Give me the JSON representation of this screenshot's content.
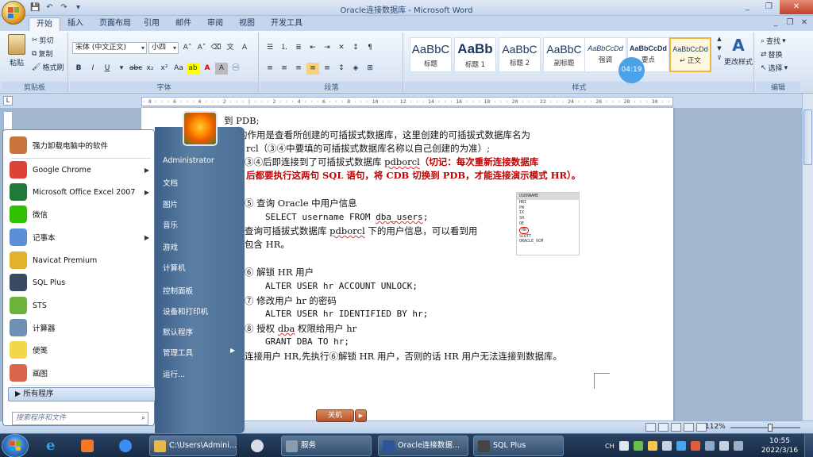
{
  "window": {
    "title": "Oracle连接数据库 - Microsoft Word",
    "controls": [
      "_",
      "❐",
      "✕"
    ]
  },
  "ribbon": {
    "tabs": [
      "开始",
      "插入",
      "页面布局",
      "引用",
      "邮件",
      "审阅",
      "视图",
      "开发工具"
    ],
    "clipboard": {
      "paste": "粘贴",
      "cut": "剪切",
      "copy": "复制",
      "format_painter": "格式刷",
      "label": "剪贴板"
    },
    "font": {
      "family": "宋体 (中文正文)",
      "size": "小四",
      "label": "字体"
    },
    "paragraph": {
      "label": "段落"
    },
    "styles": {
      "items": [
        {
          "sample": "AaBbC",
          "name": "标题"
        },
        {
          "sample": "AaBb",
          "name": "标题 1"
        },
        {
          "sample": "AaBbC",
          "name": "标题 2"
        },
        {
          "sample": "AaBbC",
          "name": "副标题"
        },
        {
          "sample": "AaBbCcDd",
          "name": "强调"
        },
        {
          "sample": "AaBbCcDd",
          "name": "要点"
        },
        {
          "sample": "AaBbCcDd",
          "name": "↵ 正文"
        }
      ],
      "change_styles": "更改样式",
      "label": "样式"
    },
    "editing": {
      "find": "查找",
      "replace": "替换",
      "select": "选择",
      "label": "编辑"
    },
    "timer": "04:19"
  },
  "ruler": {
    "marks": "· 8 · · · 6 · · · 4 · · · 2 · · · | · · · 2 · · · 4 · · · 6 · · · 8 · · · 10 · · · 12 · · · 14 · · · 16 · · · 18 · · · 20 · · · 22 · · · 24 · · · 26 · · · 28 · · · 30 · · · 32 · · · 34 · · · 36 · · · 38 · · · 40 · · · 42 · · · 44 · · · 46 · · · 48"
  },
  "document": {
    "lines": {
      "l1": "到 PDB;",
      "l2": "的作用是查看所创建的可插拔式数据库，这里创建的可插拔式数据库名为",
      "l3a": "rcl（③④中要填的可插拔式数据库名称以自己创建的为准）;",
      "l4a": "③④后即连接到了可插拔式数据库 ",
      "l4b": "pdborcl",
      "l4c": "（切记：每次重新连接数据库",
      "l5": "后都要执行这两句 SQL 语句，将 CDB 切换到 PDB，才能连接演示模式 HR）。",
      "s5_title": "⑤  查询 Oracle 中用户信息",
      "s5_sql_a": "SELECT username FROM ",
      "s5_sql_b": "dba_users",
      "s5_sql_c": ";",
      "s5_desc1a": "查询可插拔式数据库 ",
      "s5_desc1b": "pdborcl",
      "s5_desc1c": " 下的用户信息，可以看到用",
      "s5_desc2": "包含 HR。",
      "s6_title": "⑥  解锁 HR 用户",
      "s6_sql": "ALTER USER hr ACCOUNT UNLOCK;",
      "s7_title": "⑦  修改用户 hr 的密码",
      "s7_sql": "ALTER USER hr IDENTIFIED BY hr;",
      "s8_title_a": "⑧  授权 ",
      "s8_title_b": "dba",
      "s8_title_c": " 权限给用户 hr",
      "s8_sql": "GRANT DBA TO hr;",
      "note": "连接用户 HR,先执行⑥解锁 HR 用户，否则的话 HR 用户无法连接到数据库。"
    },
    "screenshot": {
      "header": "USERNAME",
      "rows": [
        "HRI",
        "PW",
        "IX",
        "SH",
        "OE",
        "HR",
        "SCOTT",
        "ORACLE_OCM"
      ],
      "circled": "HR"
    }
  },
  "statusbar": {
    "zoom": "112%"
  },
  "start_menu": {
    "left_items": [
      {
        "label": "强力卸载电脑中的软件",
        "color": "#c8743a",
        "arrow": ""
      },
      {
        "label": "Google Chrome",
        "color": "#db4437",
        "arrow": "▶"
      },
      {
        "label": "Microsoft Office Excel 2007",
        "color": "#1f7a3a",
        "arrow": "▶"
      },
      {
        "label": "微信",
        "color": "#2dc100",
        "arrow": ""
      },
      {
        "label": "记事本",
        "color": "#5b8fd6",
        "arrow": "▶"
      },
      {
        "label": "Navicat Premium",
        "color": "#e3b22a",
        "arrow": ""
      },
      {
        "label": "SQL Plus",
        "color": "#3a4a60",
        "arrow": ""
      },
      {
        "label": "STS",
        "color": "#6cb33e",
        "arrow": ""
      },
      {
        "label": "计算器",
        "color": "#6f8fb5",
        "arrow": ""
      },
      {
        "label": "便笺",
        "color": "#f2d64b",
        "arrow": ""
      },
      {
        "label": "画图",
        "color": "#d9664a",
        "arrow": ""
      }
    ],
    "all_programs": "所有程序",
    "search_placeholder": "搜索程序和文件",
    "right_items": [
      {
        "label": "Administrator",
        "arrow": ""
      },
      {
        "label": "文档",
        "arrow": ""
      },
      {
        "label": "图片",
        "arrow": ""
      },
      {
        "label": "音乐",
        "arrow": ""
      },
      {
        "label": "游戏",
        "arrow": ""
      },
      {
        "label": "计算机",
        "arrow": ""
      },
      {
        "label": "控制面板",
        "arrow": ""
      },
      {
        "label": "设备和打印机",
        "arrow": ""
      },
      {
        "label": "默认程序",
        "arrow": ""
      },
      {
        "label": "管理工具",
        "arrow": "▶"
      },
      {
        "label": "运行...",
        "arrow": ""
      }
    ],
    "shutdown": "关机"
  },
  "taskbar": {
    "buttons": [
      {
        "label": "C:\\Users\\Admini...",
        "color": "#e6b84a"
      },
      {
        "label": "服务",
        "color": "#8a9bb0"
      },
      {
        "label": "Oracle连接数据...",
        "color": "#2b579a"
      },
      {
        "label": "SQL Plus",
        "color": "#444"
      }
    ],
    "tray_lang": "CH",
    "time": "10:55",
    "date": "2022/3/16"
  }
}
